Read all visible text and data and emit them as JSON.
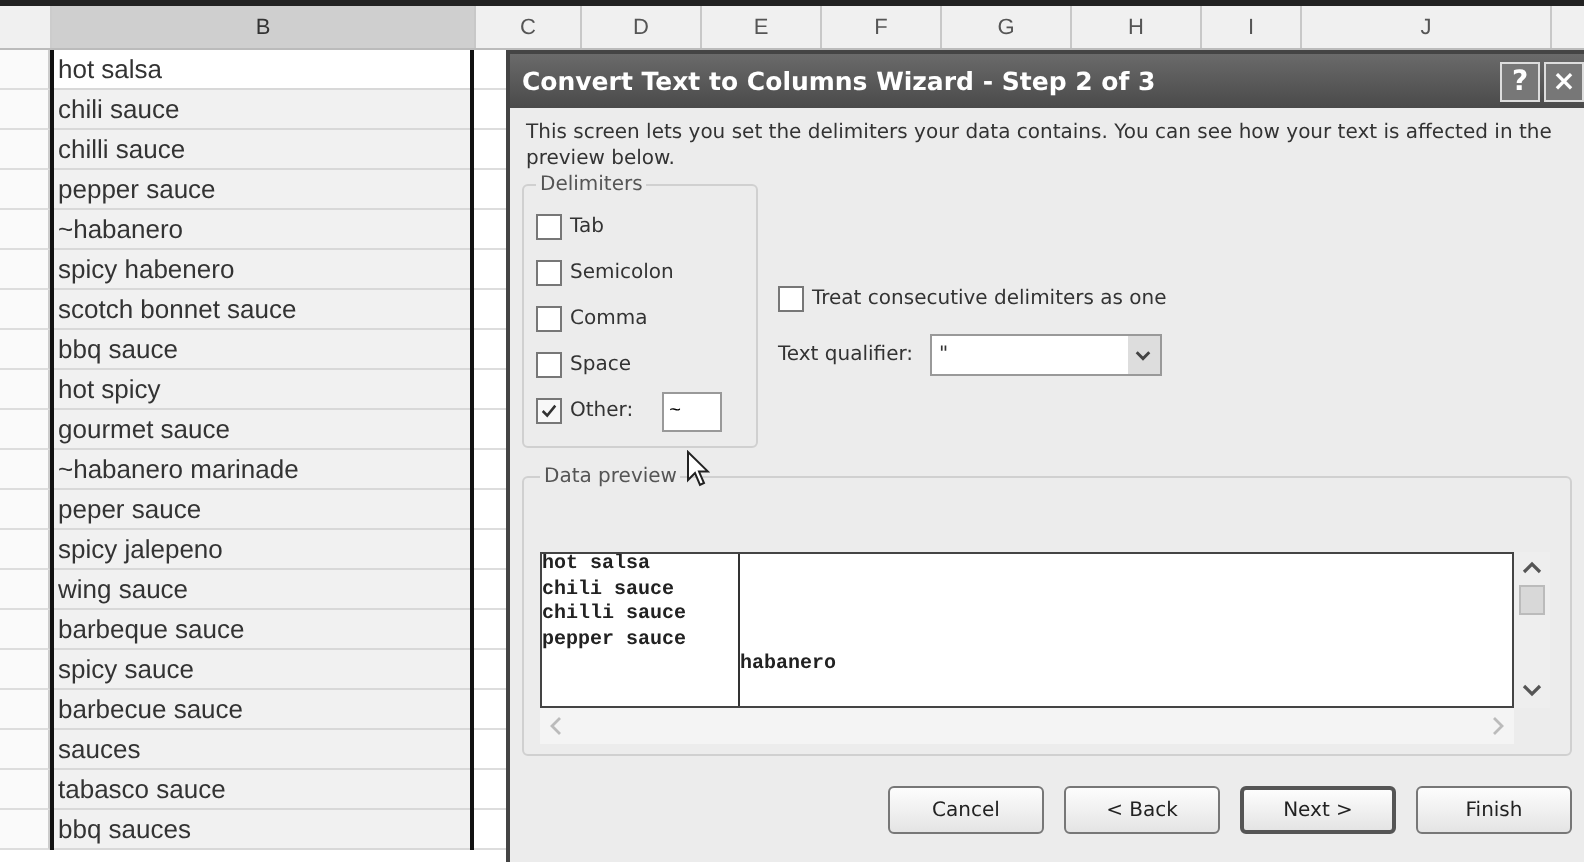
{
  "sheet": {
    "columns": [
      {
        "label": "B",
        "selected": true
      },
      {
        "label": "C",
        "selected": false
      },
      {
        "label": "D",
        "selected": false
      },
      {
        "label": "E",
        "selected": false
      },
      {
        "label": "F",
        "selected": false
      },
      {
        "label": "G",
        "selected": false
      },
      {
        "label": "H",
        "selected": false
      },
      {
        "label": "I",
        "selected": false
      },
      {
        "label": "J",
        "selected": false
      }
    ],
    "cells": [
      {
        "text": "hot salsa",
        "active": true
      },
      {
        "text": "chili sauce",
        "active": false
      },
      {
        "text": "chilli sauce",
        "active": false
      },
      {
        "text": "pepper sauce",
        "active": false
      },
      {
        "text": "~habanero",
        "active": false
      },
      {
        "text": "spicy habenero",
        "active": false
      },
      {
        "text": "scotch bonnet sauce",
        "active": false
      },
      {
        "text": "bbq sauce",
        "active": false
      },
      {
        "text": "hot spicy",
        "active": false
      },
      {
        "text": "gourmet sauce",
        "active": false
      },
      {
        "text": "~habanero marinade",
        "active": false
      },
      {
        "text": "peper sauce",
        "active": false
      },
      {
        "text": "spicy jalepeno",
        "active": false
      },
      {
        "text": "wing sauce",
        "active": false
      },
      {
        "text": "barbeque sauce",
        "active": false
      },
      {
        "text": "spicy sauce",
        "active": false
      },
      {
        "text": "barbecue sauce",
        "active": false
      },
      {
        "text": "sauces",
        "active": false
      },
      {
        "text": "tabasco sauce",
        "active": false
      },
      {
        "text": "bbq sauces",
        "active": false
      }
    ]
  },
  "dialog": {
    "title": "Convert Text to Columns Wizard - Step 2 of 3",
    "help": "?",
    "close": "×",
    "intro": "This screen lets you set the delimiters your data contains.  You can see how your text is affected in the preview below.",
    "delimiters": {
      "legend": "Delimiters",
      "items": [
        {
          "label": "Tab",
          "checked": false
        },
        {
          "label": "Semicolon",
          "checked": false
        },
        {
          "label": "Comma",
          "checked": false
        },
        {
          "label": "Space",
          "checked": false
        },
        {
          "label": "Other:",
          "checked": true,
          "value": "~"
        }
      ]
    },
    "consecutive": {
      "label": "Treat consecutive delimiters as one",
      "checked": false
    },
    "qualifier": {
      "label": "Text qualifier:",
      "value": "\""
    },
    "preview": {
      "legend": "Data preview",
      "rows": [
        {
          "column_1": "hot salsa"
        },
        {
          "column_1": "chili sauce"
        },
        {
          "column_1": "chilli sauce"
        },
        {
          "column_1": "pepper sauce"
        },
        {
          "column_2": "habanero"
        }
      ]
    },
    "buttons": [
      {
        "label": "Cancel",
        "default": false
      },
      {
        "label": "< Back",
        "default": false
      },
      {
        "label": "Next >",
        "default": true
      },
      {
        "label": "Finish",
        "default": false
      }
    ]
  }
}
